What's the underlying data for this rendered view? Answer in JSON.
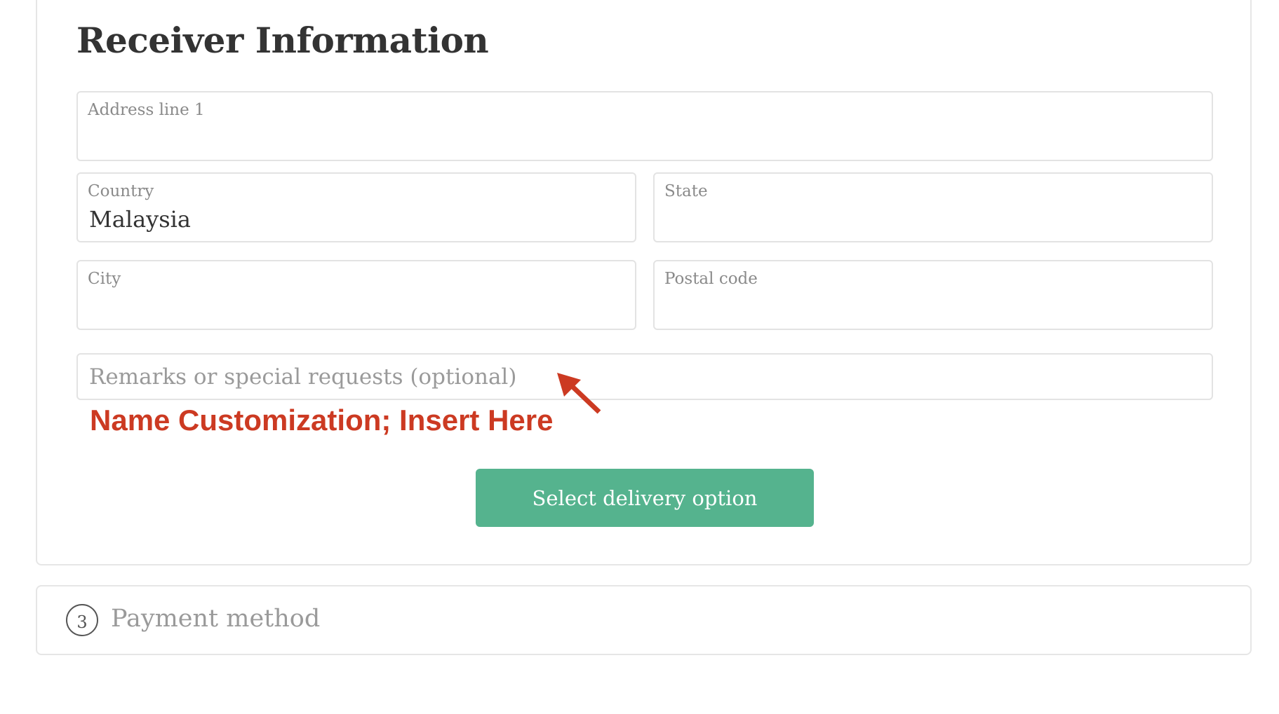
{
  "section": {
    "title": "Receiver Information"
  },
  "fields": {
    "address_line1": {
      "label": "Address line 1",
      "value": ""
    },
    "country": {
      "label": "Country",
      "value": "Malaysia"
    },
    "state": {
      "label": "State",
      "value": ""
    },
    "city": {
      "label": "City",
      "value": ""
    },
    "postal_code": {
      "label": "Postal code",
      "value": ""
    },
    "remarks": {
      "placeholder": "Remarks or special requests (optional)",
      "value": ""
    }
  },
  "annotation": {
    "text": "Name Customization; Insert Here",
    "color": "#cc3a22",
    "arrow_icon": "arrow-up-left-icon"
  },
  "actions": {
    "select_delivery_label": "Select delivery option",
    "button_color": "#55b38e"
  },
  "next_step": {
    "number": "3",
    "label": "Payment method"
  }
}
